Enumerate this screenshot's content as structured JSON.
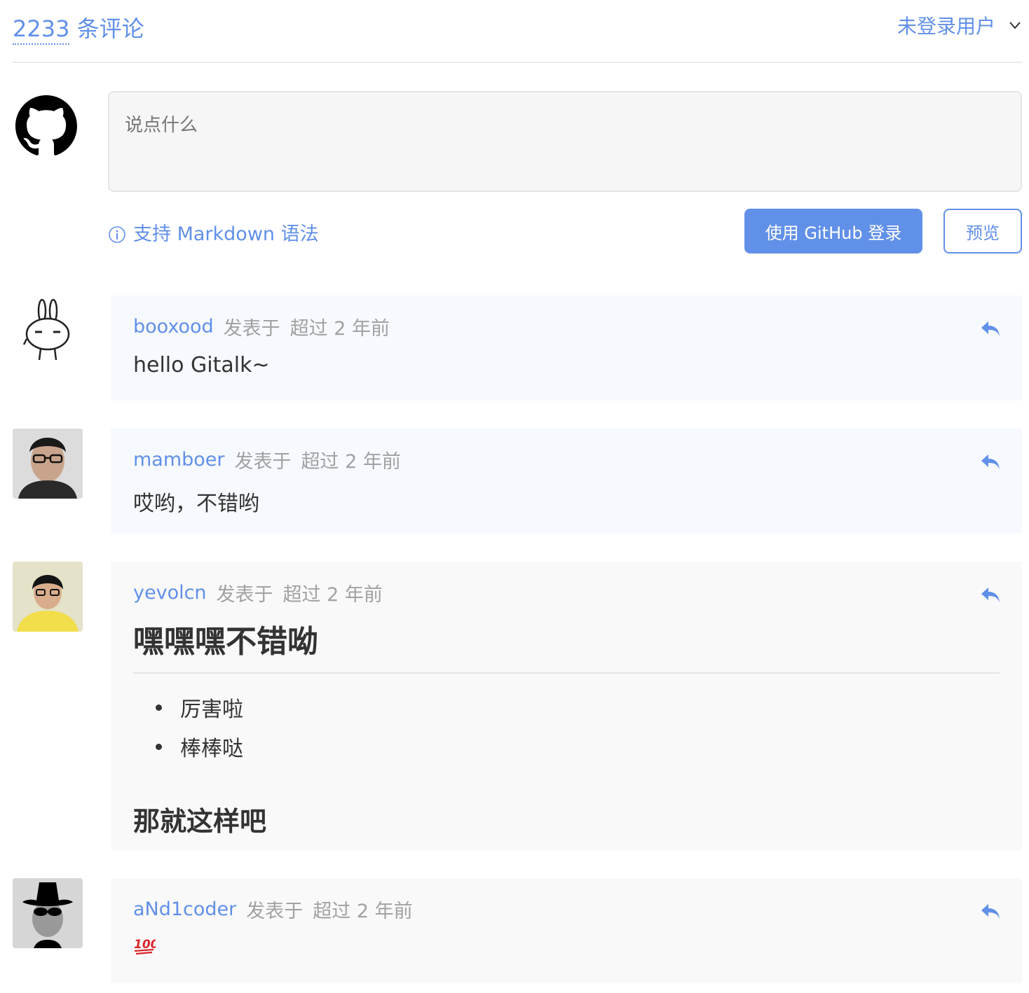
{
  "header": {
    "count_number": "2233",
    "count_label": " 条评论",
    "user_label": "未登录用户"
  },
  "editor": {
    "placeholder": "说点什么"
  },
  "toolbar": {
    "markdown_tip": "支持 Markdown 语法",
    "login_label": "使用 GitHub 登录",
    "preview_label": "预览"
  },
  "comments": [
    {
      "author": "booxood",
      "posted": "发表于",
      "time": "超过 2 年前",
      "text": "hello Gitalk~"
    },
    {
      "author": "mamboer",
      "posted": "发表于",
      "time": "超过 2 年前",
      "text": "哎哟，不错哟"
    },
    {
      "author": "yevolcn",
      "posted": "发表于",
      "time": "超过 2 年前",
      "heading": "嘿嘿嘿不错呦",
      "items": [
        "厉害啦",
        "棒棒哒"
      ],
      "subheading": "那就这样吧"
    },
    {
      "author": "aNd1coder",
      "posted": "发表于",
      "time": "超过 2 年前",
      "emoji": "100-emoji"
    }
  ],
  "colors": {
    "accent": "#6190e8",
    "meta": "#a1a1a1",
    "bubble_blue": "#f6f9fe",
    "bubble_gray": "#f9f9f9"
  }
}
